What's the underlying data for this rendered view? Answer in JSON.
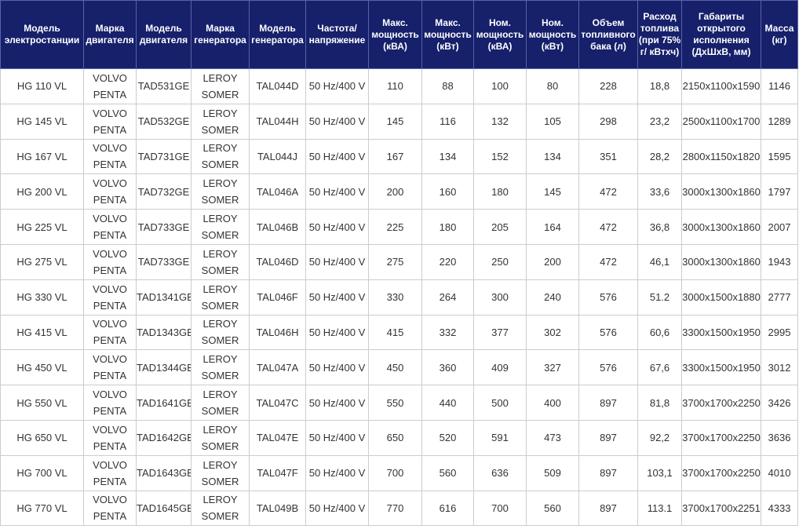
{
  "table": {
    "headers": [
      "Модель электростанции",
      "Марка двигателя",
      "Модель двигателя",
      "Марка генератора",
      "Модель генератора",
      "Частота/ напряжение",
      "Макс. мощность (кВА)",
      "Макс. мощность (кВт)",
      "Ном. мощность (кВА)",
      "Ном. мощность (кВт)",
      "Объем топливного бака (л)",
      "Расход топлива (при 75% г/ кВтхч)",
      "Габариты открытого исполнения (ДхШхВ, мм)",
      "Масса (кг)"
    ],
    "rows": [
      {
        "model": "HG 110 VL",
        "engine_brand_1": "VOLVO",
        "engine_brand_2": "PENTA",
        "engine_model": "TAD531GE",
        "gen_brand_1": "LEROY",
        "gen_brand_2": "SOMER",
        "gen_model": "TAL044D",
        "freq": "50 Hz/400 V",
        "max_kva": "110",
        "max_kw": "88",
        "nom_kva": "100",
        "nom_kw": "80",
        "tank": "228",
        "fuel": "18,8",
        "dims": "2150x1100x1590",
        "mass": "1146"
      },
      {
        "model": "HG 145 VL",
        "engine_brand_1": "VOLVO",
        "engine_brand_2": "PENTA",
        "engine_model": "TAD532GE",
        "gen_brand_1": "LEROY",
        "gen_brand_2": "SOMER",
        "gen_model": "TAL044H",
        "freq": "50 Hz/400 V",
        "max_kva": "145",
        "max_kw": "116",
        "nom_kva": "132",
        "nom_kw": "105",
        "tank": "298",
        "fuel": "23,2",
        "dims": "2500x1100x1700",
        "mass": "1289"
      },
      {
        "model": "HG 167 VL",
        "engine_brand_1": "VOLVO",
        "engine_brand_2": "PENTA",
        "engine_model": "TAD731GE",
        "gen_brand_1": "LEROY",
        "gen_brand_2": "SOMER",
        "gen_model": "TAL044J",
        "freq": "50 Hz/400 V",
        "max_kva": "167",
        "max_kw": "134",
        "nom_kva": "152",
        "nom_kw": "134",
        "tank": "351",
        "fuel": "28,2",
        "dims": "2800x1150x1820",
        "mass": "1595"
      },
      {
        "model": "HG 200 VL",
        "engine_brand_1": "VOLVO",
        "engine_brand_2": "PENTA",
        "engine_model": "TAD732GE",
        "gen_brand_1": "LEROY",
        "gen_brand_2": "SOMER",
        "gen_model": "TAL046A",
        "freq": "50 Hz/400 V",
        "max_kva": "200",
        "max_kw": "160",
        "nom_kva": "180",
        "nom_kw": "145",
        "tank": "472",
        "fuel": "33,6",
        "dims": "3000x1300x1860",
        "mass": "1797"
      },
      {
        "model": "HG 225 VL",
        "engine_brand_1": "VOLVO",
        "engine_brand_2": "PENTA",
        "engine_model": "TAD733GE",
        "gen_brand_1": "LEROY",
        "gen_brand_2": "SOMER",
        "gen_model": "TAL046B",
        "freq": "50 Hz/400 V",
        "max_kva": "225",
        "max_kw": "180",
        "nom_kva": "205",
        "nom_kw": "164",
        "tank": "472",
        "fuel": "36,8",
        "dims": "3000x1300x1860",
        "mass": "2007"
      },
      {
        "model": "HG 275 VL",
        "engine_brand_1": "VOLVO",
        "engine_brand_2": "PENTA",
        "engine_model": "TAD733GE",
        "gen_brand_1": "LEROY",
        "gen_brand_2": "SOMER",
        "gen_model": "TAL046D",
        "freq": "50 Hz/400 V",
        "max_kva": "275",
        "max_kw": "220",
        "nom_kva": "250",
        "nom_kw": "200",
        "tank": "472",
        "fuel": "46,1",
        "dims": "3000x1300x1860",
        "mass": "1943"
      },
      {
        "model": "HG 330 VL",
        "engine_brand_1": "VOLVO",
        "engine_brand_2": "PENTA",
        "engine_model": "TAD1341GE",
        "gen_brand_1": "LEROY",
        "gen_brand_2": "SOMER",
        "gen_model": "TAL046F",
        "freq": "50 Hz/400 V",
        "max_kva": "330",
        "max_kw": "264",
        "nom_kva": "300",
        "nom_kw": "240",
        "tank": "576",
        "fuel": "51.2",
        "dims": "3000x1500x1880",
        "mass": "2777"
      },
      {
        "model": "HG 415 VL",
        "engine_brand_1": "VOLVO",
        "engine_brand_2": "PENTA",
        "engine_model": "TAD1343GE",
        "gen_brand_1": "LEROY",
        "gen_brand_2": "SOMER",
        "gen_model": "TAL046H",
        "freq": "50 Hz/400 V",
        "max_kva": "415",
        "max_kw": "332",
        "nom_kva": "377",
        "nom_kw": "302",
        "tank": "576",
        "fuel": "60,6",
        "dims": "3300x1500x1950",
        "mass": "2995"
      },
      {
        "model": "HG 450 VL",
        "engine_brand_1": "VOLVO",
        "engine_brand_2": "PENTA",
        "engine_model": "TAD1344GE",
        "gen_brand_1": "LEROY",
        "gen_brand_2": "SOMER",
        "gen_model": "TAL047A",
        "freq": "50 Hz/400 V",
        "max_kva": "450",
        "max_kw": "360",
        "nom_kva": "409",
        "nom_kw": "327",
        "tank": "576",
        "fuel": "67,6",
        "dims": "3300x1500x1950",
        "mass": "3012"
      },
      {
        "model": "HG 550 VL",
        "engine_brand_1": "VOLVO",
        "engine_brand_2": "PENTA",
        "engine_model": "TAD1641GE",
        "gen_brand_1": "LEROY",
        "gen_brand_2": "SOMER",
        "gen_model": "TAL047C",
        "freq": "50 Hz/400 V",
        "max_kva": "550",
        "max_kw": "440",
        "nom_kva": "500",
        "nom_kw": "400",
        "tank": "897",
        "fuel": "81,8",
        "dims": "3700x1700x2250",
        "mass": "3426"
      },
      {
        "model": "HG 650 VL",
        "engine_brand_1": "VOLVO",
        "engine_brand_2": "PENTA",
        "engine_model": "TAD1642GE",
        "gen_brand_1": "LEROY",
        "gen_brand_2": "SOMER",
        "gen_model": "TAL047E",
        "freq": "50 Hz/400 V",
        "max_kva": "650",
        "max_kw": "520",
        "nom_kva": "591",
        "nom_kw": "473",
        "tank": "897",
        "fuel": "92,2",
        "dims": "3700x1700x2250",
        "mass": "3636"
      },
      {
        "model": "HG 700 VL",
        "engine_brand_1": "VOLVO",
        "engine_brand_2": "PENTA",
        "engine_model": "TAD1643GE",
        "gen_brand_1": "LEROY",
        "gen_brand_2": "SOMER",
        "gen_model": "TAL047F",
        "freq": "50 Hz/400 V",
        "max_kva": "700",
        "max_kw": "560",
        "nom_kva": "636",
        "nom_kw": "509",
        "tank": "897",
        "fuel": "103,1",
        "dims": "3700x1700x2250",
        "mass": "4010"
      },
      {
        "model": "HG 770 VL",
        "engine_brand_1": "VOLVO",
        "engine_brand_2": "PENTA",
        "engine_model": "TAD1645GE",
        "gen_brand_1": "LEROY",
        "gen_brand_2": "SOMER",
        "gen_model": "TAL049B",
        "freq": "50 Hz/400 V",
        "max_kva": "770",
        "max_kw": "616",
        "nom_kva": "700",
        "nom_kw": "560",
        "tank": "897",
        "fuel": "113.1",
        "dims": "3700x1700x2251",
        "mass": "4333"
      }
    ]
  }
}
